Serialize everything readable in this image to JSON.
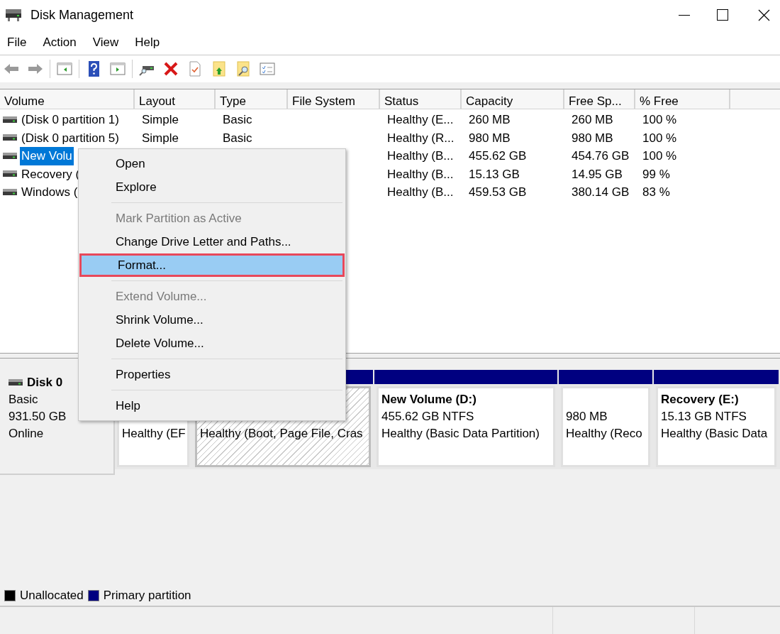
{
  "window": {
    "title": "Disk Management"
  },
  "menu_bar": [
    "File",
    "Action",
    "View",
    "Help"
  ],
  "table": {
    "columns": [
      "Volume",
      "Layout",
      "Type",
      "File System",
      "Status",
      "Capacity",
      "Free Sp...",
      "% Free"
    ],
    "rows": [
      {
        "selected": false,
        "cells": [
          "(Disk 0 partition 1)",
          "Simple",
          "Basic",
          "",
          "Healthy (E...",
          "260 MB",
          "260 MB",
          "100 %"
        ]
      },
      {
        "selected": false,
        "cells": [
          "(Disk 0 partition 5)",
          "Simple",
          "Basic",
          "",
          "Healthy (R...",
          "980 MB",
          "980 MB",
          "100 %"
        ]
      },
      {
        "selected": true,
        "cells": [
          "New Volu",
          "",
          "",
          "",
          "Healthy (B...",
          "455.62 GB",
          "454.76 GB",
          "100 %"
        ]
      },
      {
        "selected": false,
        "cells": [
          "Recovery (",
          "",
          "",
          "",
          "Healthy (B...",
          "15.13 GB",
          "14.95 GB",
          "99 %"
        ]
      },
      {
        "selected": false,
        "cells": [
          "Windows (",
          "",
          "",
          "",
          "Healthy (B...",
          "459.53 GB",
          "380.14 GB",
          "83 %"
        ]
      }
    ]
  },
  "disk": {
    "name": "Disk 0",
    "type": "Basic",
    "size": "931.50 GB",
    "state": "Online",
    "partitions": [
      {
        "hatched": false,
        "status": "Healthy (EF"
      },
      {
        "hatched": true,
        "status": "Healthy (Boot, Page File, Cras"
      },
      {
        "hatched": false,
        "title": "New Volume  (D:)",
        "size": "455.62 GB NTFS",
        "status": "Healthy (Basic Data Partition)"
      },
      {
        "hatched": false,
        "size": "980 MB",
        "status": "Healthy (Reco"
      },
      {
        "hatched": false,
        "title": "Recovery  (E:)",
        "size": "15.13 GB NTFS",
        "status": "Healthy (Basic Data"
      }
    ]
  },
  "legend": [
    {
      "label": "Unallocated",
      "color": "#000000"
    },
    {
      "label": "Primary partition",
      "color": "#000080"
    }
  ],
  "context_menu": [
    {
      "kind": "item",
      "label": "Open",
      "disabled": false,
      "selected": false
    },
    {
      "kind": "item",
      "label": "Explore",
      "disabled": false,
      "selected": false
    },
    {
      "kind": "separator"
    },
    {
      "kind": "item",
      "label": "Mark Partition as Active",
      "disabled": true,
      "selected": false
    },
    {
      "kind": "item",
      "label": "Change Drive Letter and Paths...",
      "disabled": false,
      "selected": false
    },
    {
      "kind": "item",
      "label": "Format...",
      "disabled": false,
      "selected": true
    },
    {
      "kind": "separator"
    },
    {
      "kind": "item",
      "label": "Extend Volume...",
      "disabled": true,
      "selected": false
    },
    {
      "kind": "item",
      "label": "Shrink Volume...",
      "disabled": false,
      "selected": false
    },
    {
      "kind": "item",
      "label": "Delete Volume...",
      "disabled": false,
      "selected": false
    },
    {
      "kind": "separator"
    },
    {
      "kind": "item",
      "label": "Properties",
      "disabled": false,
      "selected": false
    },
    {
      "kind": "separator"
    },
    {
      "kind": "item",
      "label": "Help",
      "disabled": false,
      "selected": false
    }
  ]
}
